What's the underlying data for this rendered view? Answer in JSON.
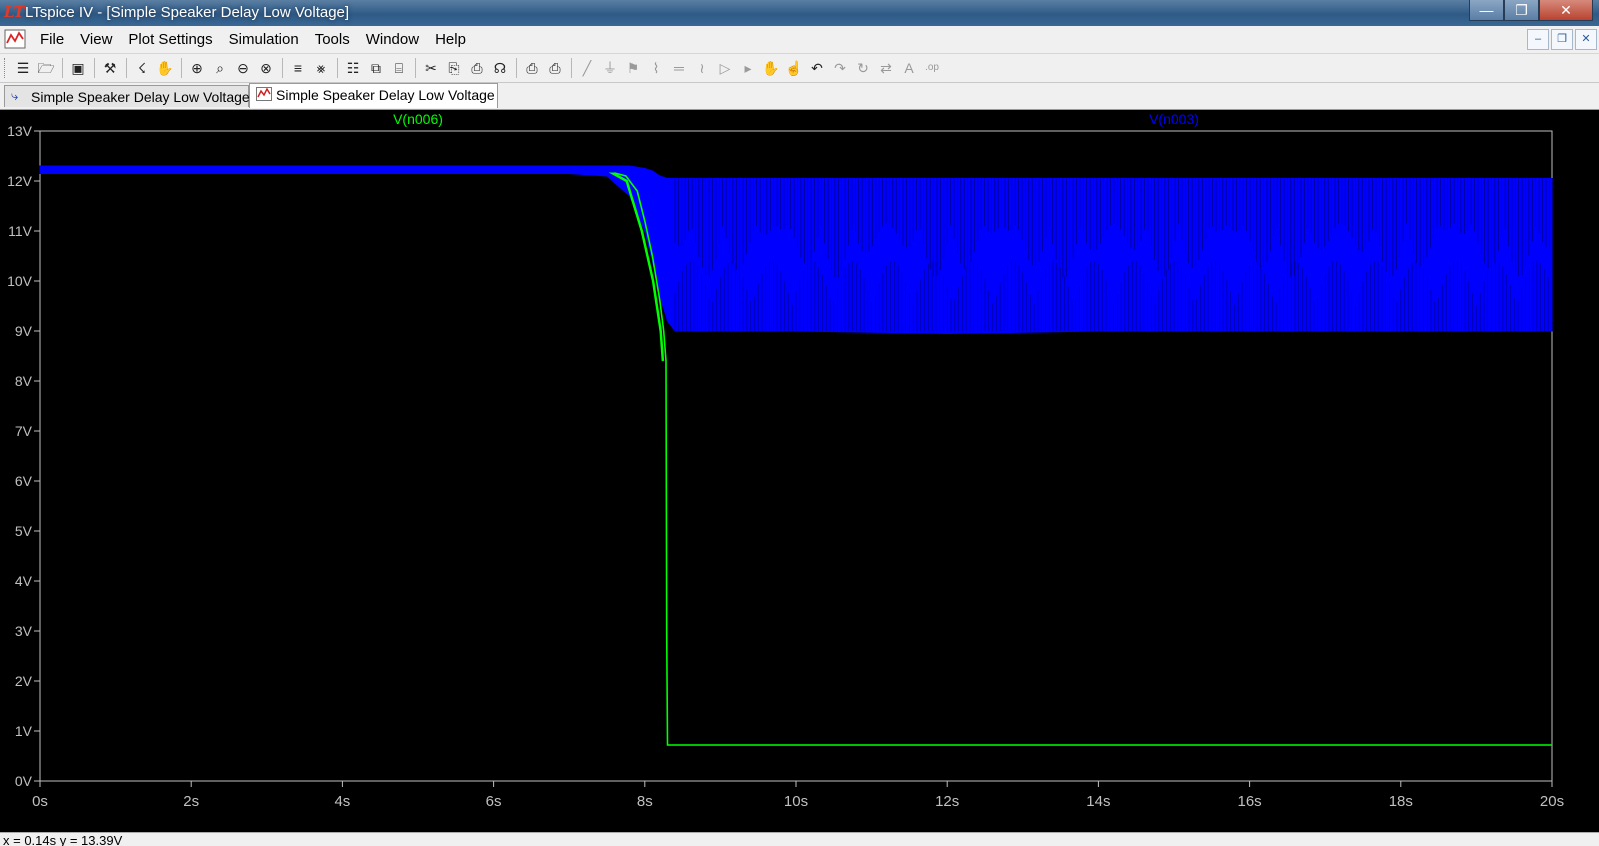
{
  "window": {
    "title": "LTspice IV - [Simple Speaker Delay Low Voltage]"
  },
  "menu": {
    "items": [
      "File",
      "View",
      "Plot Settings",
      "Simulation",
      "Tools",
      "Window",
      "Help"
    ]
  },
  "tabs": [
    {
      "label": "Simple Speaker Delay Low Voltage",
      "kind": "schematic"
    },
    {
      "label": "Simple Speaker Delay Low Voltage",
      "kind": "waveform"
    }
  ],
  "toolbar": {
    "groups": [
      [
        "new-schematic-icon",
        "open-icon"
      ],
      [
        "save-icon"
      ],
      [
        "control-panel-icon"
      ],
      [
        "run-icon",
        "halt-icon"
      ],
      [
        "zoom-area-icon",
        "zoom-in-icon",
        "zoom-out-icon",
        "autorange-icon"
      ],
      [
        "plot-settings-icon",
        "add-trace-icon"
      ],
      [
        "tile-horizontal-icon",
        "cascade-icon",
        "tile-vertical-icon"
      ],
      [
        "cut-icon",
        "copy-icon",
        "paste-icon",
        "find-icon"
      ],
      [
        "print-preview-icon",
        "print-icon"
      ],
      [
        "wire-icon",
        "ground-icon",
        "label-net-icon",
        "resistor-icon",
        "capacitor-icon",
        "inductor-icon",
        "diode-icon",
        "component-icon",
        "move-icon",
        "drag-icon",
        "undo-icon",
        "redo-icon",
        "rotate-icon",
        "mirror-icon",
        "text-icon",
        "spice-directive-icon"
      ]
    ]
  },
  "status": {
    "readout": "x = 0.14s   y = 13.39V"
  },
  "colors": {
    "background": "#000000",
    "axis": "#c0c0c0",
    "n006": "#00ff00",
    "n003": "#0000ff"
  },
  "chart_data": {
    "type": "line",
    "xlabel": "",
    "ylabel": "",
    "x_unit": "s",
    "y_unit": "V",
    "xlim": [
      0,
      20
    ],
    "ylim": [
      0,
      13
    ],
    "x_ticks": [
      "0s",
      "2s",
      "4s",
      "6s",
      "8s",
      "10s",
      "12s",
      "14s",
      "16s",
      "18s",
      "20s"
    ],
    "y_ticks": [
      "0V",
      "1V",
      "2V",
      "3V",
      "4V",
      "5V",
      "6V",
      "7V",
      "8V",
      "9V",
      "10V",
      "11V",
      "12V",
      "13V"
    ],
    "grid": false,
    "legend": "top",
    "series": [
      {
        "name": "V(n006)",
        "color": "#00ff00",
        "x": [
          0,
          2,
          4,
          6,
          7,
          7.5,
          7.75,
          7.9,
          8.0,
          8.1,
          8.2,
          8.25,
          8.28,
          8.29,
          8.3,
          10,
          14,
          20
        ],
        "y": [
          12.2,
          12.2,
          12.2,
          12.2,
          12.2,
          12.2,
          12.1,
          11.8,
          11.2,
          10.5,
          9.6,
          9.0,
          8.4,
          3.0,
          0.72,
          0.72,
          0.72,
          0.72
        ]
      },
      {
        "name": "V(n003)",
        "color": "#0000ff",
        "envelope": true,
        "x": [
          0,
          2,
          4,
          6,
          7.0,
          7.5,
          7.8,
          8.0,
          8.1,
          8.2,
          8.3,
          8.4,
          10,
          12,
          14,
          16,
          18,
          20
        ],
        "y_max": [
          12.3,
          12.3,
          12.3,
          12.3,
          12.3,
          12.3,
          12.3,
          12.25,
          12.2,
          12.1,
          12.05,
          12.05,
          12.05,
          12.05,
          12.05,
          12.05,
          12.05,
          12.05
        ],
        "y_min": [
          12.15,
          12.15,
          12.15,
          12.15,
          12.15,
          12.1,
          11.7,
          11.0,
          10.4,
          9.7,
          9.2,
          9.0,
          9.0,
          8.95,
          9.0,
          9.0,
          9.0,
          9.0
        ]
      }
    ]
  }
}
